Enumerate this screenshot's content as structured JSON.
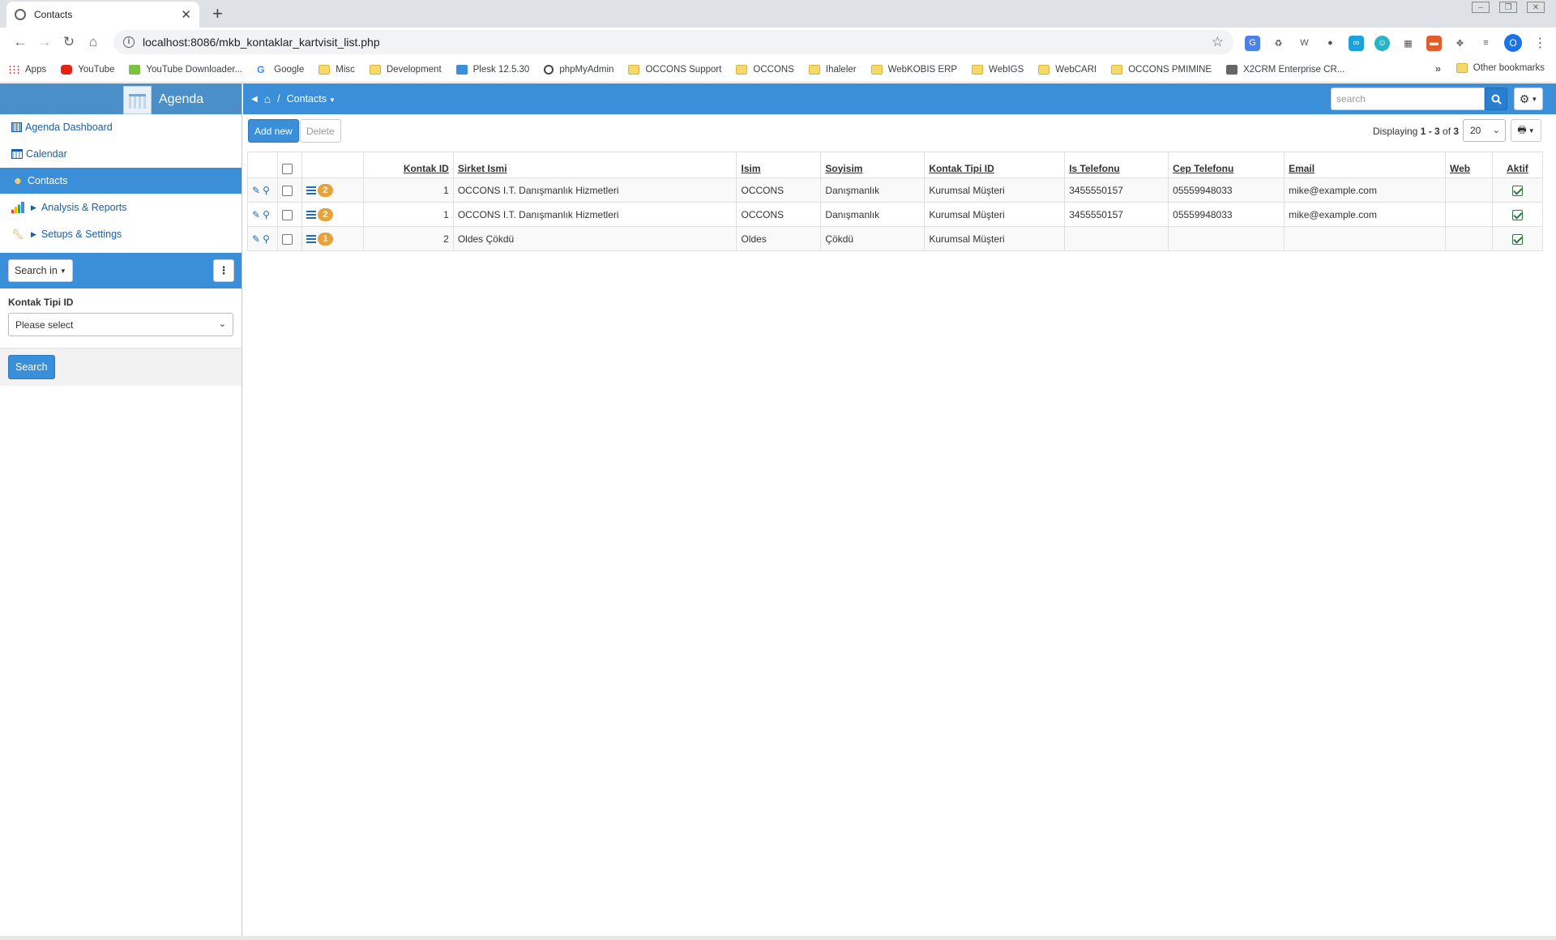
{
  "browser": {
    "tab_title": "Contacts",
    "url": "localhost:8086/mkb_kontaklar_kartvisit_list.php",
    "profile_initial": "O",
    "bookmarks": [
      "Apps",
      "YouTube",
      "YouTube Downloader...",
      "Google",
      "Misc",
      "Development",
      "Plesk 12.5.30",
      "phpMyAdmin",
      "OCCONS Support",
      "OCCONS",
      "Ihaleler",
      "WebKOBIS ERP",
      "WebIGS",
      "WebCARI",
      "OCCONS PMIMINE",
      "X2CRM Enterprise CR..."
    ],
    "other_bookmarks": "Other bookmarks"
  },
  "app": {
    "brand": "Agenda",
    "menu": [
      {
        "label": "Agenda Dashboard",
        "icon": "dashboard-icon"
      },
      {
        "label": "Calendar",
        "icon": "calendar-icon"
      },
      {
        "label": "Contacts",
        "icon": "contacts-icon",
        "active": true
      },
      {
        "label": "Analysis & Reports",
        "icon": "chart-icon"
      },
      {
        "label": "Setups & Settings",
        "icon": "wrench-icon"
      }
    ],
    "search_in": "Search in",
    "filter_label": "Kontak Tipi ID",
    "filter_value": "Please select",
    "search_button": "Search",
    "breadcrumb": "Contacts",
    "search_placeholder": "search",
    "add_new": "Add new",
    "delete": "Delete",
    "displaying_prefix": "Displaying ",
    "displaying_range": "1 - 3",
    "displaying_of": " of ",
    "displaying_total": "3",
    "page_size": "20"
  },
  "table": {
    "headers": [
      "Kontak ID",
      "Sirket Ismi",
      "Isim",
      "Soyisim",
      "Kontak Tipi ID",
      "Is Telefonu",
      "Cep Telefonu",
      "Email",
      "Web",
      "Aktif"
    ],
    "rows": [
      {
        "badge": "2",
        "id": "1",
        "company": "OCCONS I.T. Danışmanlık Hizmetleri",
        "name": "OCCONS",
        "surname": "Danışmanlık",
        "type": "Kurumsal Müşteri",
        "phone": "3455550157",
        "mobile": "05559948033",
        "email": "mike@example.com",
        "web": "",
        "active": true
      },
      {
        "badge": "2",
        "id": "1",
        "company": "OCCONS I.T. Danışmanlık Hizmetleri",
        "name": "OCCONS",
        "surname": "Danışmanlık",
        "type": "Kurumsal Müşteri",
        "phone": "3455550157",
        "mobile": "05559948033",
        "email": "mike@example.com",
        "web": "",
        "active": true
      },
      {
        "badge": "1",
        "id": "2",
        "company": "Oldes Çökdü",
        "name": "Oldes",
        "surname": "Çökdü",
        "type": "Kurumsal Müşteri",
        "phone": "",
        "mobile": "",
        "email": "",
        "web": "",
        "active": true
      }
    ]
  }
}
